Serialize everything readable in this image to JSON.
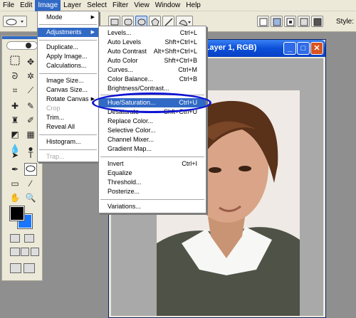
{
  "menubar": {
    "items": [
      "File",
      "Edit",
      "Image",
      "Layer",
      "Select",
      "Filter",
      "View",
      "Window",
      "Help"
    ],
    "active": "Image"
  },
  "options": {
    "style_label": "Style:"
  },
  "document": {
    "title": "(Layer 1, RGB)"
  },
  "image_menu": {
    "mode": "Mode",
    "adjustments": "Adjustments",
    "duplicate": "Duplicate...",
    "apply_image": "Apply Image...",
    "calculations": "Calculations...",
    "image_size": "Image Size...",
    "canvas_size": "Canvas Size...",
    "rotate_canvas": "Rotate Canvas",
    "crop": "Crop",
    "trim": "Trim...",
    "reveal_all": "Reveal All",
    "histogram": "Histogram...",
    "trap": "Trap..."
  },
  "adjustments_menu": {
    "levels": {
      "label": "Levels...",
      "shortcut": "Ctrl+L"
    },
    "auto_levels": {
      "label": "Auto Levels",
      "shortcut": "Shft+Ctrl+L"
    },
    "auto_contrast": {
      "label": "Auto Contrast",
      "shortcut": "Alt+Shft+Ctrl+L"
    },
    "auto_color": {
      "label": "Auto Color",
      "shortcut": "Shft+Ctrl+B"
    },
    "curves": {
      "label": "Curves...",
      "shortcut": "Ctrl+M"
    },
    "color_balance": {
      "label": "Color Balance...",
      "shortcut": "Ctrl+B"
    },
    "brightness_contrast": {
      "label": "Brightness/Contrast..."
    },
    "hue_saturation": {
      "label": "Hue/Saturation...",
      "shortcut": "Ctrl+U"
    },
    "desaturate": {
      "label": "Desaturate",
      "shortcut": "Shft+Ctrl+U"
    },
    "replace_color": {
      "label": "Replace Color..."
    },
    "selective_color": {
      "label": "Selective Color..."
    },
    "channel_mixer": {
      "label": "Channel Mixer..."
    },
    "gradient_map": {
      "label": "Gradient Map..."
    },
    "invert": {
      "label": "Invert",
      "shortcut": "Ctrl+I"
    },
    "equalize": {
      "label": "Equalize"
    },
    "threshold": {
      "label": "Threshold..."
    },
    "posterize": {
      "label": "Posterize..."
    },
    "variations": {
      "label": "Variations..."
    }
  },
  "toolbox": {
    "text_tool_glyph": "T"
  },
  "colors": {
    "highlight": "#316ac5",
    "annotation_ellipse": "#0f14d3",
    "foreground": "#000000",
    "background": "#1977ff"
  }
}
